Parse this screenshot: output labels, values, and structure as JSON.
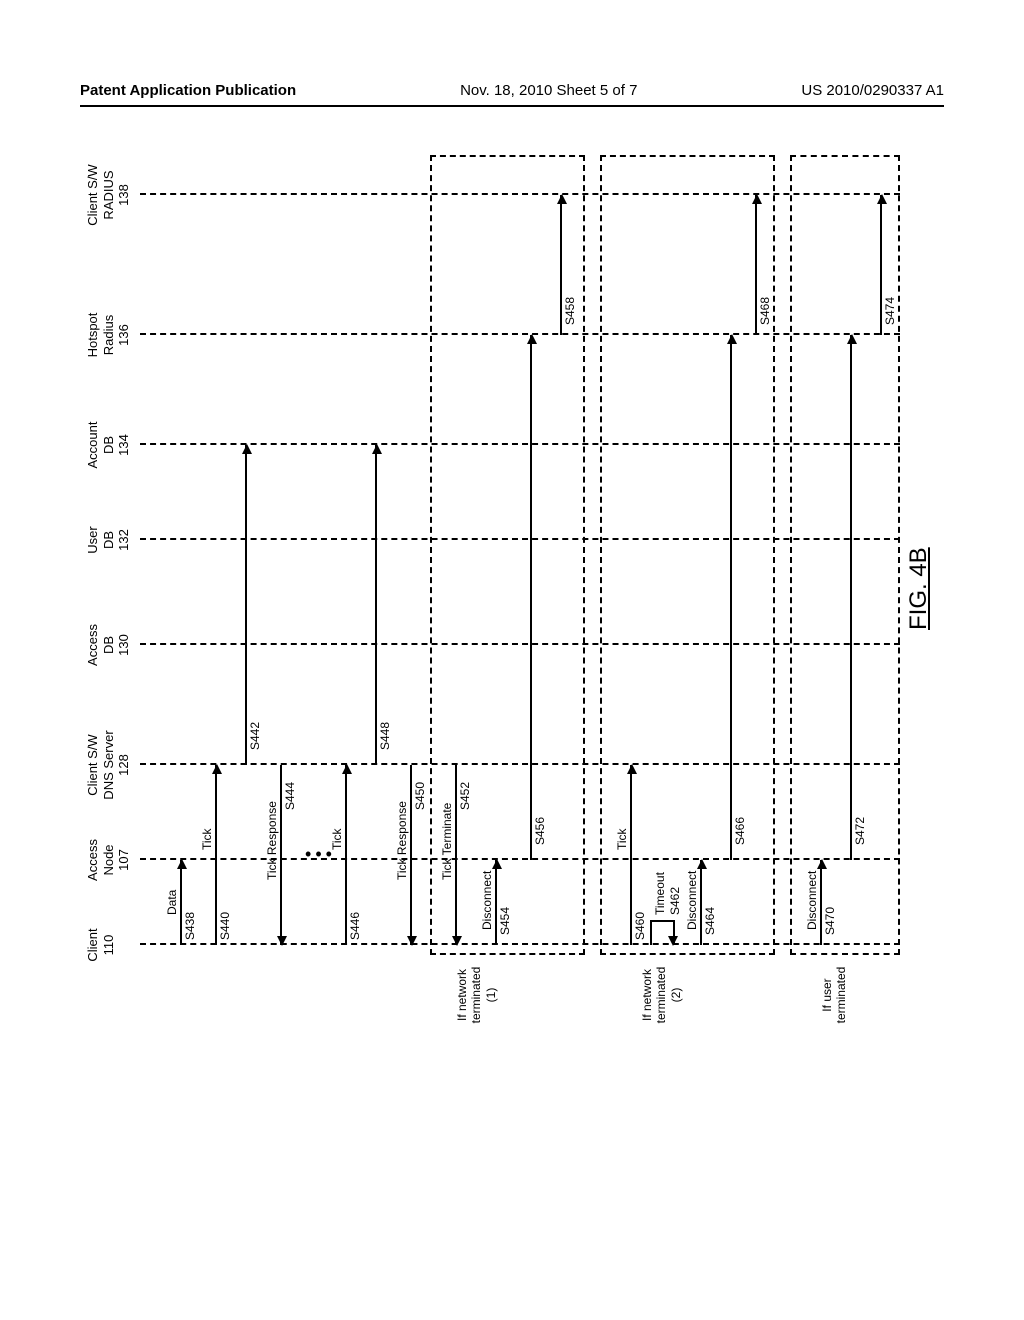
{
  "header": {
    "left": "Patent Application Publication",
    "center": "Nov. 18, 2010  Sheet 5 of 7",
    "right": "US 2010/0290337 A1"
  },
  "actors": {
    "client": {
      "name": "Client",
      "id": "110"
    },
    "access_node": {
      "name": "Access\nNode",
      "id": "107"
    },
    "dns_server": {
      "name": "Client S/W\nDNS Server",
      "id": "128"
    },
    "access_db": {
      "name": "Access\nDB",
      "id": "130"
    },
    "user_db": {
      "name": "User\nDB",
      "id": "132"
    },
    "account_db": {
      "name": "Account\nDB",
      "id": "134"
    },
    "hotspot_radius": {
      "name": "Hotspot\nRadius",
      "id": "136"
    },
    "client_radius": {
      "name": "Client S/W\nRADIUS",
      "id": "138"
    }
  },
  "messages": {
    "data": "Data",
    "s438": "S438",
    "tick1": "Tick",
    "s440": "S440",
    "tick_response1": "Tick Response",
    "s442": "S442",
    "s444": "S444",
    "tick2": "Tick",
    "s446": "S446",
    "tick_response2": "Tick Response",
    "s448": "S448",
    "s450": "S450",
    "tick_terminate": "Tick Terminate",
    "s452": "S452",
    "disconnect1": "Disconnect",
    "s454": "S454",
    "s456": "S456",
    "s458": "S458",
    "tick3": "Tick",
    "s460": "S460",
    "timeout": "Timeout",
    "s462": "S462",
    "disconnect2": "Disconnect",
    "s464": "S464",
    "s466": "S466",
    "s468": "S468",
    "disconnect3": "Disconnect",
    "s470": "S470",
    "s472": "S472",
    "s474": "S474"
  },
  "blocks": {
    "net_term1": "If network\nterminated\n(1)",
    "net_term2": "If network\nterminated\n(2)",
    "user_term": "If user\nterminated"
  },
  "figure_label": "FIG. 4B"
}
